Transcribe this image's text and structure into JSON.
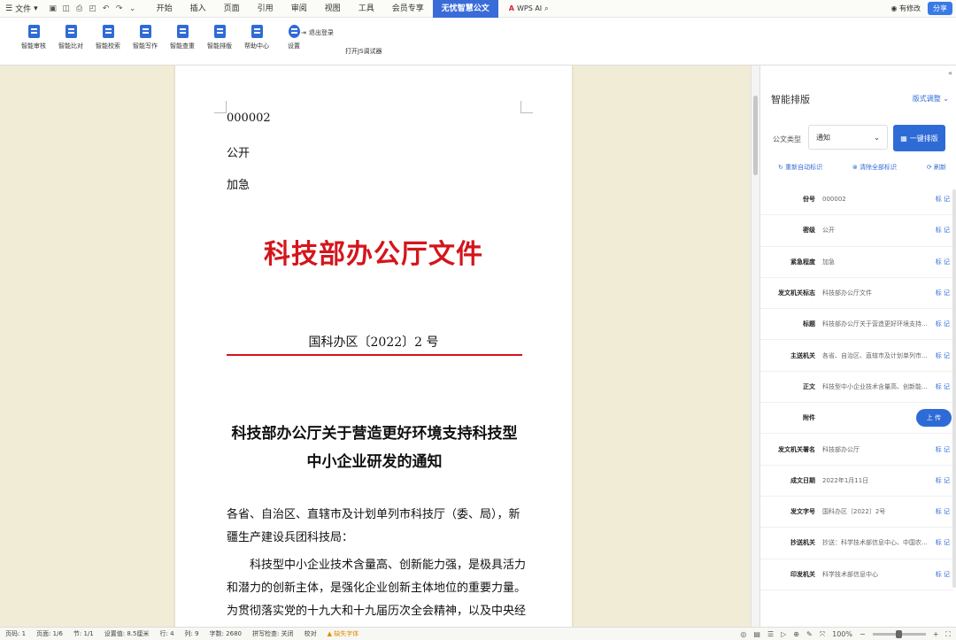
{
  "menubar": {
    "file_label": "文件",
    "menus": [
      "开始",
      "插入",
      "页面",
      "引用",
      "审阅",
      "视图",
      "工具",
      "会员专享",
      "无忧智慧公文"
    ],
    "active_menu": "无忧智慧公文",
    "wps_ai": "WPS AI",
    "user": "有修改",
    "share": "分享"
  },
  "ribbon": {
    "tools": [
      {
        "label": "智能审核",
        "icon": "audit-icon"
      },
      {
        "label": "智能比对",
        "icon": "compare-icon"
      },
      {
        "label": "智能校索",
        "icon": "proofread-icon"
      },
      {
        "label": "智能写作",
        "icon": "write-icon"
      },
      {
        "label": "智能查重",
        "icon": "duplicate-check-icon"
      },
      {
        "label": "智能排版",
        "icon": "layout-icon"
      },
      {
        "label": "帮助中心",
        "icon": "help-icon"
      },
      {
        "label": "设置",
        "icon": "gear-icon"
      }
    ],
    "logout": "退出登录",
    "js_debug": "打开JS调试器"
  },
  "document": {
    "doc_number": "000002",
    "secrecy": "公开",
    "urgency": "加急",
    "header": "科技部办公厅文件",
    "reference": "国科办区〔2022〕2 号",
    "title": "科技部办公厅关于营造更好环境支持科技型中小企业研发的通知",
    "addressee": "各省、自治区、直辖市及计划单列市科技厅（委、局），新疆生产建设兵团科技局：",
    "body": "科技型中小企业技术含量高、创新能力强，是极具活力和潜力的创新主体，是强化企业创新主体地位的重要力量。为贯彻落实党的十九大和十九届历次全会精神，以及中央经济工作会议精"
  },
  "panel": {
    "title": "智能排版",
    "adjust": "版式调整",
    "type_label": "公文类型",
    "type_value": "通知",
    "oneclick": "一键排版",
    "actions": [
      "重新自动标识",
      "清除全部标识",
      "刷新"
    ],
    "mark_label": "标 记",
    "upload_label": "上 传",
    "rows": [
      {
        "label": "份号",
        "value": "000002"
      },
      {
        "label": "密级",
        "value": "公开"
      },
      {
        "label": "紧急程度",
        "value": "加急"
      },
      {
        "label": "发文机关标志",
        "value": "科技部办公厅文件"
      },
      {
        "label": "标题",
        "value": "科技部办公厅关于营造更好环境支持..."
      },
      {
        "label": "主送机关",
        "value": "各省、自治区、直辖市及计划单列市..."
      },
      {
        "label": "正文",
        "value": "科技型中小企业技术含量高、创新能..."
      },
      {
        "label": "附件",
        "value": ""
      },
      {
        "label": "发文机关署名",
        "value": "科技部办公厅"
      },
      {
        "label": "成文日期",
        "value": "2022年1月11日"
      },
      {
        "label": "发文字号",
        "value": "国科办区〔2022〕2号"
      },
      {
        "label": "抄送机关",
        "value": "抄送：科学技术部信息中心、中国农..."
      },
      {
        "label": "印发机关",
        "value": "科学技术部信息中心"
      }
    ]
  },
  "status": {
    "items": [
      "页码: 1",
      "页面: 1/6",
      "节: 1/1",
      "设置值: 8.5厘米",
      "行: 4",
      "列: 9",
      "字数: 2680",
      "拼写检查: 关闭",
      "校对"
    ],
    "warning": "缺失字体",
    "zoom": "100%"
  }
}
